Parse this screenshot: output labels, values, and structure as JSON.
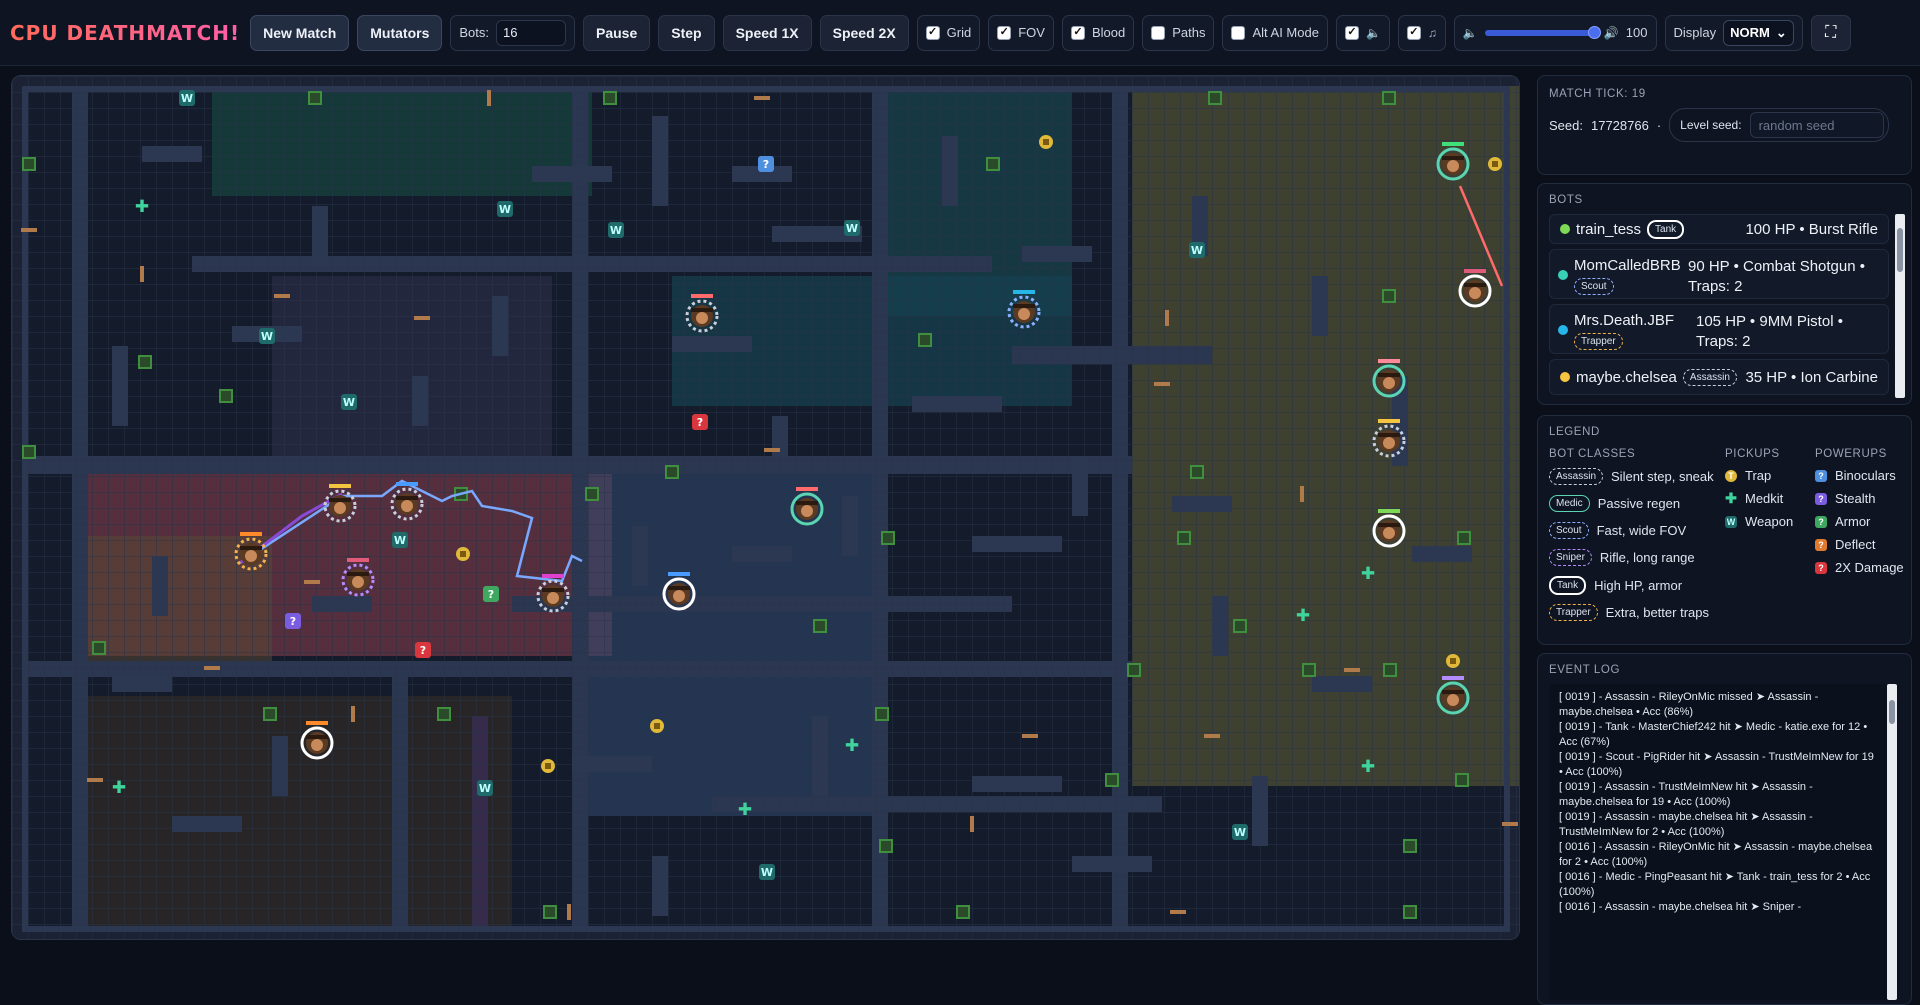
{
  "toolbar": {
    "brand": "CPU DEATHMATCH!",
    "new_match": "New Match",
    "mutators": "Mutators",
    "bots_label": "Bots:",
    "bots_value": "16",
    "pause": "Pause",
    "step": "Step",
    "speed1": "Speed 1X",
    "speed2": "Speed 2X",
    "toggles": [
      {
        "label": "Grid",
        "checked": true
      },
      {
        "label": "FOV",
        "checked": true
      },
      {
        "label": "Blood",
        "checked": true
      },
      {
        "label": "Paths",
        "checked": false
      },
      {
        "label": "Alt AI Mode",
        "checked": false
      }
    ],
    "sound_checked": true,
    "music_checked": true,
    "volume": "100",
    "volume_level": 1.0,
    "display_label": "Display",
    "display_value": "NORM"
  },
  "status": {
    "tick_label": "MATCH TICK: 19",
    "seed_label": "Seed:",
    "seed_value": "17728766",
    "seed_sep": "·",
    "level_seed_label": "Level seed:",
    "level_seed_placeholder": "random seed"
  },
  "bots_panel": {
    "title": "BOTS",
    "bots": [
      {
        "name": "train_tess",
        "class": "Tank",
        "stats": "100 HP • Burst Rifle",
        "color": "#7ed957"
      },
      {
        "name": "MomCalledBRB",
        "class": "Scout",
        "stats": "90 HP • Combat Shotgun • Traps: 2",
        "color": "#39d0b8"
      },
      {
        "name": "Mrs.Death.JBF",
        "class": "Trapper",
        "stats": "105 HP • 9MM Pistol • Traps: 2",
        "color": "#27b6e8"
      },
      {
        "name": "maybe.chelsea",
        "class": "Assassin",
        "stats": "35 HP • Ion Carbine",
        "color": "#f5c542"
      }
    ]
  },
  "legend": {
    "title": "LEGEND",
    "classes_title": "BOT CLASSES",
    "classes": [
      {
        "tag": "Assassin",
        "desc": "Silent step, sneak"
      },
      {
        "tag": "Medic",
        "desc": "Passive regen"
      },
      {
        "tag": "Scout",
        "desc": "Fast, wide FOV"
      },
      {
        "tag": "Sniper",
        "desc": "Rifle, long range"
      },
      {
        "tag": "Tank",
        "desc": "High HP, armor"
      },
      {
        "tag": "Trapper",
        "desc": "Extra, better traps"
      }
    ],
    "pickups_title": "PICKUPS",
    "pickups": [
      {
        "label": "Trap",
        "color": "#e0b93a"
      },
      {
        "label": "Medkit",
        "color": "#3ed49b"
      },
      {
        "label": "Weapon",
        "color": "#5ec9c2"
      }
    ],
    "powerups_title": "POWERUPS",
    "powerups": [
      {
        "label": "Binoculars",
        "color": "#4f8fe0"
      },
      {
        "label": "Stealth",
        "color": "#7a5ce0"
      },
      {
        "label": "Armor",
        "color": "#3fa860"
      },
      {
        "label": "Deflect",
        "color": "#e07a2f"
      },
      {
        "label": "2X Damage",
        "color": "#d9363e"
      }
    ]
  },
  "event_log": {
    "title": "EVENT LOG",
    "lines": [
      "[ 0019 ] - Assassin - RileyOnMic missed ➤ Assassin - maybe.chelsea • Acc (86%)",
      "[ 0019 ] - Tank - MasterChief242 hit ➤ Medic - katie.exe for 12 • Acc (67%)",
      "[ 0019 ] - Scout - PigRider hit ➤ Assassin - TrustMeImNew for 19 • Acc (100%)",
      "[ 0019 ] - Assassin - TrustMeImNew hit ➤ Assassin - maybe.chelsea for 19 • Acc (100%)",
      "[ 0019 ] - Assassin - maybe.chelsea hit ➤ Assassin - TrustMeImNew for 2 • Acc (100%)",
      "[ 0016 ] - Assassin - RileyOnMic hit ➤ Assassin - maybe.chelsea for 2 • Acc (100%)",
      "[ 0016 ] - Medic - PingPeasant hit ➤ Tank - train_tess for 2 • Acc (100%)",
      "[ 0016 ] - Assassin - maybe.chelsea hit ➤ Sniper -"
    ]
  }
}
